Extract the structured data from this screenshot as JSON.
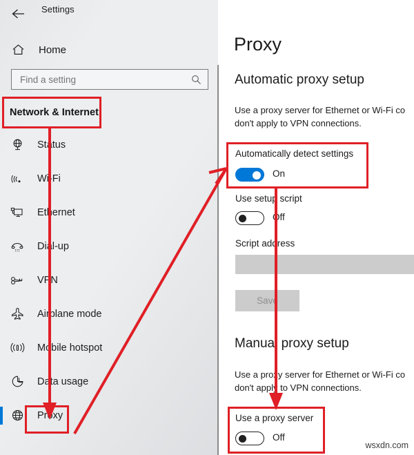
{
  "window": {
    "title": "Settings",
    "back_icon": "back-arrow-icon"
  },
  "sidebar": {
    "home": {
      "label": "Home",
      "icon": "home-icon"
    },
    "search": {
      "placeholder": "Find a setting",
      "value": "",
      "icon": "search-icon"
    },
    "section_header": "Network & Internet",
    "items": [
      {
        "label": "Status",
        "icon": "status-globe-icon",
        "selected": false
      },
      {
        "label": "Wi-Fi",
        "icon": "wifi-icon",
        "selected": false
      },
      {
        "label": "Ethernet",
        "icon": "ethernet-monitor-icon",
        "selected": false
      },
      {
        "label": "Dial-up",
        "icon": "dialup-phone-icon",
        "selected": false
      },
      {
        "label": "VPN",
        "icon": "vpn-key-icon",
        "selected": false
      },
      {
        "label": "Airplane mode",
        "icon": "airplane-icon",
        "selected": false
      },
      {
        "label": "Mobile hotspot",
        "icon": "hotspot-signal-icon",
        "selected": false
      },
      {
        "label": "Data usage",
        "icon": "pie-chart-icon",
        "selected": false
      },
      {
        "label": "Proxy",
        "icon": "globe-icon",
        "selected": true
      }
    ]
  },
  "main": {
    "page_title": "Proxy",
    "automatic_section": {
      "heading": "Automatic proxy setup",
      "description": "Use a proxy server for Ethernet or Wi-Fi co\ndon't apply to VPN connections.",
      "auto_detect": {
        "label": "Automatically detect settings",
        "state": "On",
        "checked": true
      },
      "setup_script": {
        "label": "Use setup script",
        "state": "Off",
        "checked": false
      },
      "script_address": {
        "label": "Script address",
        "value": "",
        "disabled": true
      },
      "save_button": {
        "label": "Save",
        "disabled": true
      }
    },
    "manual_section": {
      "heading": "Manual proxy setup",
      "description": "Use a proxy server for Ethernet or Wi-Fi co\ndon't apply to VPN connections.",
      "use_proxy": {
        "label": "Use a proxy server",
        "state": "Off",
        "checked": false
      }
    }
  },
  "annotations": {
    "color": "#e01f26",
    "boxes": [
      {
        "name": "network-internet-highlight",
        "target": "Network & Internet"
      },
      {
        "name": "proxy-highlight",
        "target": "Proxy"
      },
      {
        "name": "auto-detect-highlight",
        "target": "Automatically detect settings"
      },
      {
        "name": "use-proxy-highlight",
        "target": "Use a proxy server"
      }
    ]
  },
  "watermark": "wsxdn.com"
}
